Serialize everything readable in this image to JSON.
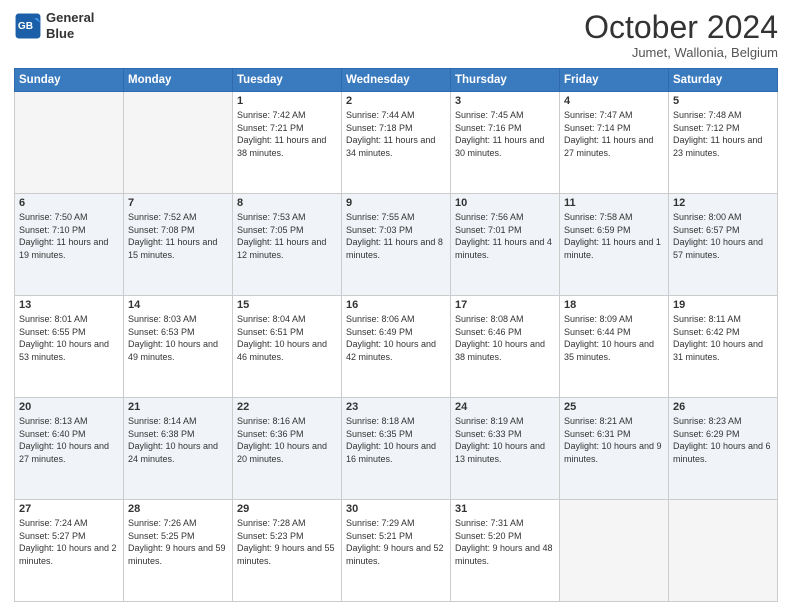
{
  "header": {
    "logo_line1": "General",
    "logo_line2": "Blue",
    "month": "October 2024",
    "location": "Jumet, Wallonia, Belgium"
  },
  "days_of_week": [
    "Sunday",
    "Monday",
    "Tuesday",
    "Wednesday",
    "Thursday",
    "Friday",
    "Saturday"
  ],
  "weeks": [
    [
      {
        "day": "",
        "sunrise": "",
        "sunset": "",
        "daylight": "",
        "empty": true
      },
      {
        "day": "",
        "sunrise": "",
        "sunset": "",
        "daylight": "",
        "empty": true
      },
      {
        "day": "1",
        "sunrise": "Sunrise: 7:42 AM",
        "sunset": "Sunset: 7:21 PM",
        "daylight": "Daylight: 11 hours and 38 minutes.",
        "empty": false
      },
      {
        "day": "2",
        "sunrise": "Sunrise: 7:44 AM",
        "sunset": "Sunset: 7:18 PM",
        "daylight": "Daylight: 11 hours and 34 minutes.",
        "empty": false
      },
      {
        "day": "3",
        "sunrise": "Sunrise: 7:45 AM",
        "sunset": "Sunset: 7:16 PM",
        "daylight": "Daylight: 11 hours and 30 minutes.",
        "empty": false
      },
      {
        "day": "4",
        "sunrise": "Sunrise: 7:47 AM",
        "sunset": "Sunset: 7:14 PM",
        "daylight": "Daylight: 11 hours and 27 minutes.",
        "empty": false
      },
      {
        "day": "5",
        "sunrise": "Sunrise: 7:48 AM",
        "sunset": "Sunset: 7:12 PM",
        "daylight": "Daylight: 11 hours and 23 minutes.",
        "empty": false
      }
    ],
    [
      {
        "day": "6",
        "sunrise": "Sunrise: 7:50 AM",
        "sunset": "Sunset: 7:10 PM",
        "daylight": "Daylight: 11 hours and 19 minutes.",
        "empty": false
      },
      {
        "day": "7",
        "sunrise": "Sunrise: 7:52 AM",
        "sunset": "Sunset: 7:08 PM",
        "daylight": "Daylight: 11 hours and 15 minutes.",
        "empty": false
      },
      {
        "day": "8",
        "sunrise": "Sunrise: 7:53 AM",
        "sunset": "Sunset: 7:05 PM",
        "daylight": "Daylight: 11 hours and 12 minutes.",
        "empty": false
      },
      {
        "day": "9",
        "sunrise": "Sunrise: 7:55 AM",
        "sunset": "Sunset: 7:03 PM",
        "daylight": "Daylight: 11 hours and 8 minutes.",
        "empty": false
      },
      {
        "day": "10",
        "sunrise": "Sunrise: 7:56 AM",
        "sunset": "Sunset: 7:01 PM",
        "daylight": "Daylight: 11 hours and 4 minutes.",
        "empty": false
      },
      {
        "day": "11",
        "sunrise": "Sunrise: 7:58 AM",
        "sunset": "Sunset: 6:59 PM",
        "daylight": "Daylight: 11 hours and 1 minute.",
        "empty": false
      },
      {
        "day": "12",
        "sunrise": "Sunrise: 8:00 AM",
        "sunset": "Sunset: 6:57 PM",
        "daylight": "Daylight: 10 hours and 57 minutes.",
        "empty": false
      }
    ],
    [
      {
        "day": "13",
        "sunrise": "Sunrise: 8:01 AM",
        "sunset": "Sunset: 6:55 PM",
        "daylight": "Daylight: 10 hours and 53 minutes.",
        "empty": false
      },
      {
        "day": "14",
        "sunrise": "Sunrise: 8:03 AM",
        "sunset": "Sunset: 6:53 PM",
        "daylight": "Daylight: 10 hours and 49 minutes.",
        "empty": false
      },
      {
        "day": "15",
        "sunrise": "Sunrise: 8:04 AM",
        "sunset": "Sunset: 6:51 PM",
        "daylight": "Daylight: 10 hours and 46 minutes.",
        "empty": false
      },
      {
        "day": "16",
        "sunrise": "Sunrise: 8:06 AM",
        "sunset": "Sunset: 6:49 PM",
        "daylight": "Daylight: 10 hours and 42 minutes.",
        "empty": false
      },
      {
        "day": "17",
        "sunrise": "Sunrise: 8:08 AM",
        "sunset": "Sunset: 6:46 PM",
        "daylight": "Daylight: 10 hours and 38 minutes.",
        "empty": false
      },
      {
        "day": "18",
        "sunrise": "Sunrise: 8:09 AM",
        "sunset": "Sunset: 6:44 PM",
        "daylight": "Daylight: 10 hours and 35 minutes.",
        "empty": false
      },
      {
        "day": "19",
        "sunrise": "Sunrise: 8:11 AM",
        "sunset": "Sunset: 6:42 PM",
        "daylight": "Daylight: 10 hours and 31 minutes.",
        "empty": false
      }
    ],
    [
      {
        "day": "20",
        "sunrise": "Sunrise: 8:13 AM",
        "sunset": "Sunset: 6:40 PM",
        "daylight": "Daylight: 10 hours and 27 minutes.",
        "empty": false
      },
      {
        "day": "21",
        "sunrise": "Sunrise: 8:14 AM",
        "sunset": "Sunset: 6:38 PM",
        "daylight": "Daylight: 10 hours and 24 minutes.",
        "empty": false
      },
      {
        "day": "22",
        "sunrise": "Sunrise: 8:16 AM",
        "sunset": "Sunset: 6:36 PM",
        "daylight": "Daylight: 10 hours and 20 minutes.",
        "empty": false
      },
      {
        "day": "23",
        "sunrise": "Sunrise: 8:18 AM",
        "sunset": "Sunset: 6:35 PM",
        "daylight": "Daylight: 10 hours and 16 minutes.",
        "empty": false
      },
      {
        "day": "24",
        "sunrise": "Sunrise: 8:19 AM",
        "sunset": "Sunset: 6:33 PM",
        "daylight": "Daylight: 10 hours and 13 minutes.",
        "empty": false
      },
      {
        "day": "25",
        "sunrise": "Sunrise: 8:21 AM",
        "sunset": "Sunset: 6:31 PM",
        "daylight": "Daylight: 10 hours and 9 minutes.",
        "empty": false
      },
      {
        "day": "26",
        "sunrise": "Sunrise: 8:23 AM",
        "sunset": "Sunset: 6:29 PM",
        "daylight": "Daylight: 10 hours and 6 minutes.",
        "empty": false
      }
    ],
    [
      {
        "day": "27",
        "sunrise": "Sunrise: 7:24 AM",
        "sunset": "Sunset: 5:27 PM",
        "daylight": "Daylight: 10 hours and 2 minutes.",
        "empty": false
      },
      {
        "day": "28",
        "sunrise": "Sunrise: 7:26 AM",
        "sunset": "Sunset: 5:25 PM",
        "daylight": "Daylight: 9 hours and 59 minutes.",
        "empty": false
      },
      {
        "day": "29",
        "sunrise": "Sunrise: 7:28 AM",
        "sunset": "Sunset: 5:23 PM",
        "daylight": "Daylight: 9 hours and 55 minutes.",
        "empty": false
      },
      {
        "day": "30",
        "sunrise": "Sunrise: 7:29 AM",
        "sunset": "Sunset: 5:21 PM",
        "daylight": "Daylight: 9 hours and 52 minutes.",
        "empty": false
      },
      {
        "day": "31",
        "sunrise": "Sunrise: 7:31 AM",
        "sunset": "Sunset: 5:20 PM",
        "daylight": "Daylight: 9 hours and 48 minutes.",
        "empty": false
      },
      {
        "day": "",
        "sunrise": "",
        "sunset": "",
        "daylight": "",
        "empty": true
      },
      {
        "day": "",
        "sunrise": "",
        "sunset": "",
        "daylight": "",
        "empty": true
      }
    ]
  ]
}
